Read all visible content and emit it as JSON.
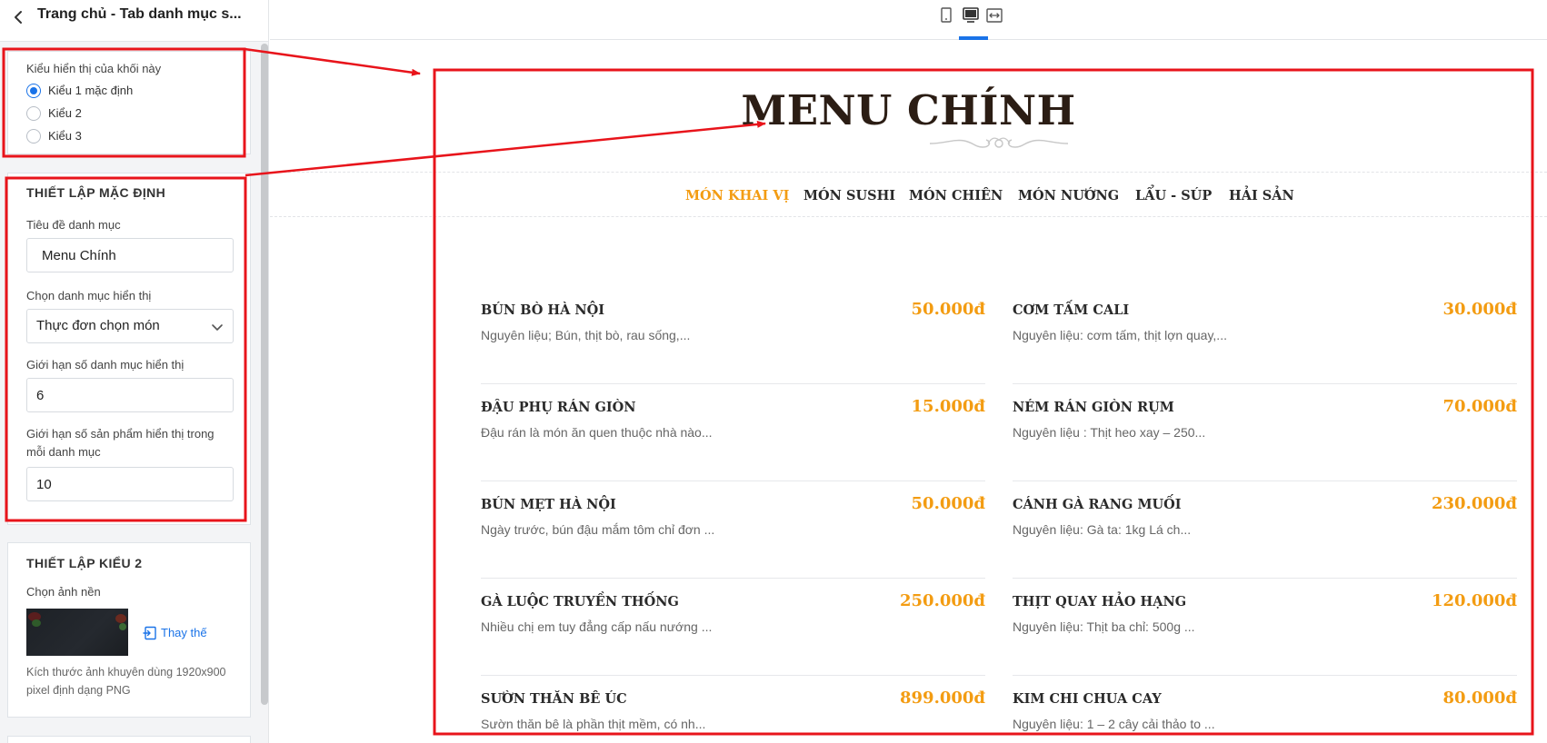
{
  "sidebar": {
    "title": "Trang chủ - Tab danh mục s...",
    "display_style": {
      "label": "Kiểu hiển thị của khối này",
      "options": [
        {
          "label": "Kiểu 1 mặc định",
          "checked": true
        },
        {
          "label": "Kiểu 2",
          "checked": false
        },
        {
          "label": "Kiểu 3",
          "checked": false
        }
      ]
    },
    "default_settings": {
      "heading": "THIẾT LẬP MẶC ĐỊNH",
      "category_title_label": "Tiêu đề danh mục",
      "category_title_value": "Menu Chính",
      "category_select_label": "Chọn danh mục hiển thị",
      "category_select_value": "Thực đơn chọn món",
      "category_limit_label": "Giới hạn số danh mục hiển thị",
      "category_limit_value": "6",
      "product_limit_label": "Giới hạn số sản phẩm hiển thị trong mỗi danh mục",
      "product_limit_value": "10"
    },
    "style2_settings": {
      "heading": "THIẾT LẬP KIỂU 2",
      "bg_label": "Chọn ảnh nền",
      "replace_label": "Thay thế",
      "bg_hint": "Kích thước ảnh khuyên dùng 1920x900 pixel định dạng PNG"
    }
  },
  "toolbar": {
    "devices": [
      "mobile-icon",
      "desktop-icon",
      "fullwidth-icon"
    ],
    "active_device": "desktop-icon"
  },
  "preview": {
    "title": "MENU CHÍNH",
    "tabs": [
      {
        "label": "MÓN KHAI VỊ",
        "active": true
      },
      {
        "label": "MÓN SUSHI",
        "active": false
      },
      {
        "label": "MÓN CHIÊN",
        "active": false
      },
      {
        "label": "MÓN NƯỚNG",
        "active": false
      },
      {
        "label": "LẨU - SÚP",
        "active": false
      },
      {
        "label": "HẢI SẢN",
        "active": false
      }
    ],
    "items": [
      {
        "name": "BÚN BÒ HÀ NỘI",
        "price": "50.000đ",
        "desc": "Nguyên liệu; Bún, thịt bò, rau sống,..."
      },
      {
        "name": "CƠM TẤM CALI",
        "price": "30.000đ",
        "desc": "Nguyên liệu: cơm tấm, thịt lợn quay,..."
      },
      {
        "name": "ĐẬU PHỤ RÁN GIÒN",
        "price": "15.000đ",
        "desc": "Đậu rán là món ăn quen thuộc nhà nào..."
      },
      {
        "name": "NÉM RÁN GIÒN RỤM",
        "price": "70.000đ",
        "desc": "Nguyên liệu : Thịt heo xay – 250..."
      },
      {
        "name": "BÚN MẸT HÀ NỘI",
        "price": "50.000đ",
        "desc": "Ngày trước, bún đậu mắm tôm chỉ đơn ..."
      },
      {
        "name": "CÁNH GÀ RANG MUỐI",
        "price": "230.000đ",
        "desc": "Nguyên liệu: Gà ta: 1kg Lá ch..."
      },
      {
        "name": "GÀ LUỘC TRUYỀN THỐNG",
        "price": "250.000đ",
        "desc": "Nhiều chị em tuy đẳng cấp nấu nướng ..."
      },
      {
        "name": "THỊT QUAY HẢO HẠNG",
        "price": "120.000đ",
        "desc": "Nguyên liệu: Thịt ba chỉ: 500g ..."
      },
      {
        "name": "SƯỜN THĂN BÊ ÚC",
        "price": "899.000đ",
        "desc": "Sườn thăn bê là phần thịt mềm, có nh..."
      },
      {
        "name": "KIM CHI CHUA CAY",
        "price": "80.000đ",
        "desc": "Nguyên liệu: 1 – 2 cây cải thảo to ..."
      }
    ]
  },
  "colors": {
    "accent_orange": "#f39c12",
    "primary_blue": "#1a73e8",
    "annotation_red": "#e8141b",
    "title_brown": "#2b1d14"
  }
}
